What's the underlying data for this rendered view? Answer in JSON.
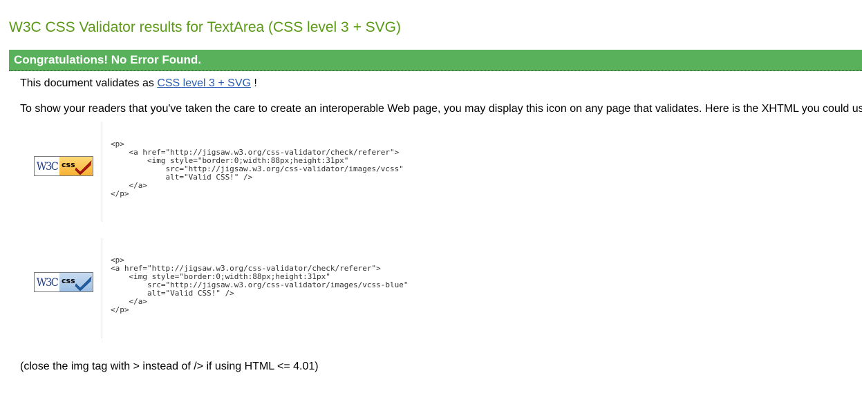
{
  "page": {
    "title": "W3C CSS Validator results for TextArea (CSS level 3 + SVG)"
  },
  "banner": {
    "text": "Congratulations! No Error Found."
  },
  "validates": {
    "prefix": "This document validates as ",
    "link": "CSS level 3 + SVG",
    "suffix": " !"
  },
  "show_text": "To show your readers that you've taken the care to create an interoperable Web page, you may display this icon on any page that validates. Here is the XHTML you could use",
  "badges": [
    {
      "alt": "Valid CSS!",
      "w3c": "W3C",
      "css": "css",
      "icon": "vcss-gold-checkmark-icon",
      "check_color": "#b0140e",
      "code": "<p>\n    <a href=\"http://jigsaw.w3.org/css-validator/check/referer\">\n        <img style=\"border:0;width:88px;height:31px\"\n            src=\"http://jigsaw.w3.org/css-validator/images/vcss\"\n            alt=\"Valid CSS!\" />\n    </a>\n</p>"
    },
    {
      "alt": "Valid CSS!",
      "w3c": "W3C",
      "css": "css",
      "icon": "vcss-blue-checkmark-icon",
      "check_color": "#1d5fa8",
      "code": "<p>\n<a href=\"http://jigsaw.w3.org/css-validator/check/referer\">\n    <img style=\"border:0;width:88px;height:31px\"\n        src=\"http://jigsaw.w3.org/css-validator/images/vcss-blue\"\n        alt=\"Valid CSS!\" />\n    </a>\n</p>"
    }
  ],
  "close_note": "(close the img tag with > instead of /> if using HTML <= 4.01)",
  "colors": {
    "title": "#5b9a16",
    "banner_bg": "#59b15b",
    "link": "#2a5db0"
  }
}
